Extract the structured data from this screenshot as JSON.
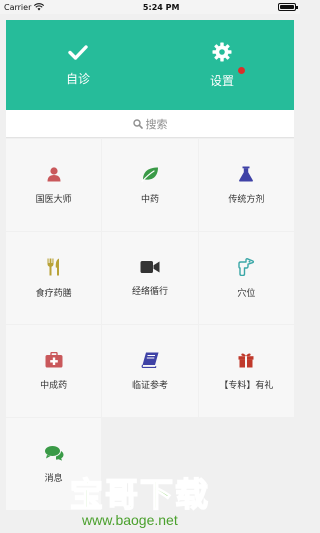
{
  "status": {
    "carrier": "Carrier",
    "time": "5:24 PM",
    "battery_level": 1.0
  },
  "header": {
    "items": [
      {
        "label": "自诊",
        "icon": "checkmark-icon"
      },
      {
        "label": "设置",
        "icon": "gear-icon",
        "badge_color": "#d9302b"
      }
    ],
    "bg_color": "#26bc9a"
  },
  "search": {
    "placeholder": "搜索",
    "icon": "search-icon"
  },
  "grid": {
    "items": [
      {
        "label": "国医大师",
        "icon": "person-icon",
        "color": "#c9585b"
      },
      {
        "label": "中药",
        "icon": "leaf-icon",
        "color": "#3a9a47"
      },
      {
        "label": "传统方剂",
        "icon": "flask-icon",
        "color": "#3f42a6"
      },
      {
        "label": "食疗药膳",
        "icon": "fork-knife-icon",
        "color": "#b8a237"
      },
      {
        "label": "经络循行",
        "icon": "video-camera-icon",
        "color": "#333333"
      },
      {
        "label": "穴位",
        "icon": "hand-point-icon",
        "color": "#3aa7a7"
      },
      {
        "label": "中成药",
        "icon": "medkit-icon",
        "color": "#c9585b"
      },
      {
        "label": "临证参考",
        "icon": "book-icon",
        "color": "#3f42a6"
      },
      {
        "label": "【专料】有礼",
        "icon": "gift-icon",
        "color": "#c0392b"
      },
      {
        "label": "消息",
        "icon": "chat-icon",
        "color": "#3a9a47"
      }
    ]
  },
  "watermark": {
    "title": "宝哥下载",
    "url": "www.baoge.net"
  }
}
